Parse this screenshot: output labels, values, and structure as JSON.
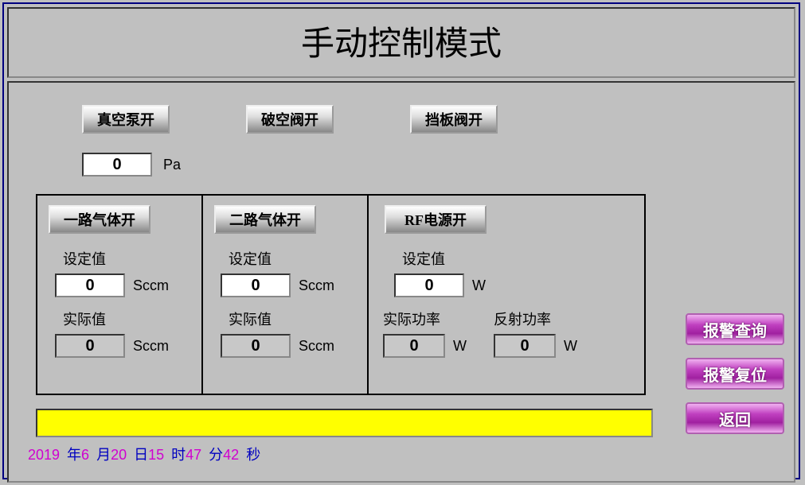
{
  "title": "手动控制模式",
  "top_buttons": {
    "vacuum_pump": "真空泵开",
    "break_valve": "破空阀开",
    "baffle_valve": "挡板阀开"
  },
  "pressure": {
    "value": "0",
    "unit": "Pa"
  },
  "gas1": {
    "button": "一路气体开",
    "set_label": "设定值",
    "set_value": "0",
    "set_unit": "Sccm",
    "act_label": "实际值",
    "act_value": "0",
    "act_unit": "Sccm"
  },
  "gas2": {
    "button": "二路气体开",
    "set_label": "设定值",
    "set_value": "0",
    "set_unit": "Sccm",
    "act_label": "实际值",
    "act_value": "0",
    "act_unit": "Sccm"
  },
  "rf": {
    "button": "RF电源开",
    "set_label": "设定值",
    "set_value": "0",
    "set_unit": "W",
    "act_label": "实际功率",
    "act_value": "0",
    "act_unit": "W",
    "ref_label": "反射功率",
    "ref_value": "0",
    "ref_unit": "W"
  },
  "status_bar": "",
  "timestamp": {
    "year": "2019",
    "year_lbl": "年",
    "month": "6",
    "month_lbl": "月",
    "day": "20",
    "day_lbl": "日",
    "hour": "15",
    "hour_lbl": "时",
    "min": "47",
    "min_lbl": "分",
    "sec": "42",
    "sec_lbl": "秒"
  },
  "side_buttons": {
    "alarm_query": "报警查询",
    "alarm_reset": "报警复位",
    "back": "返回"
  }
}
